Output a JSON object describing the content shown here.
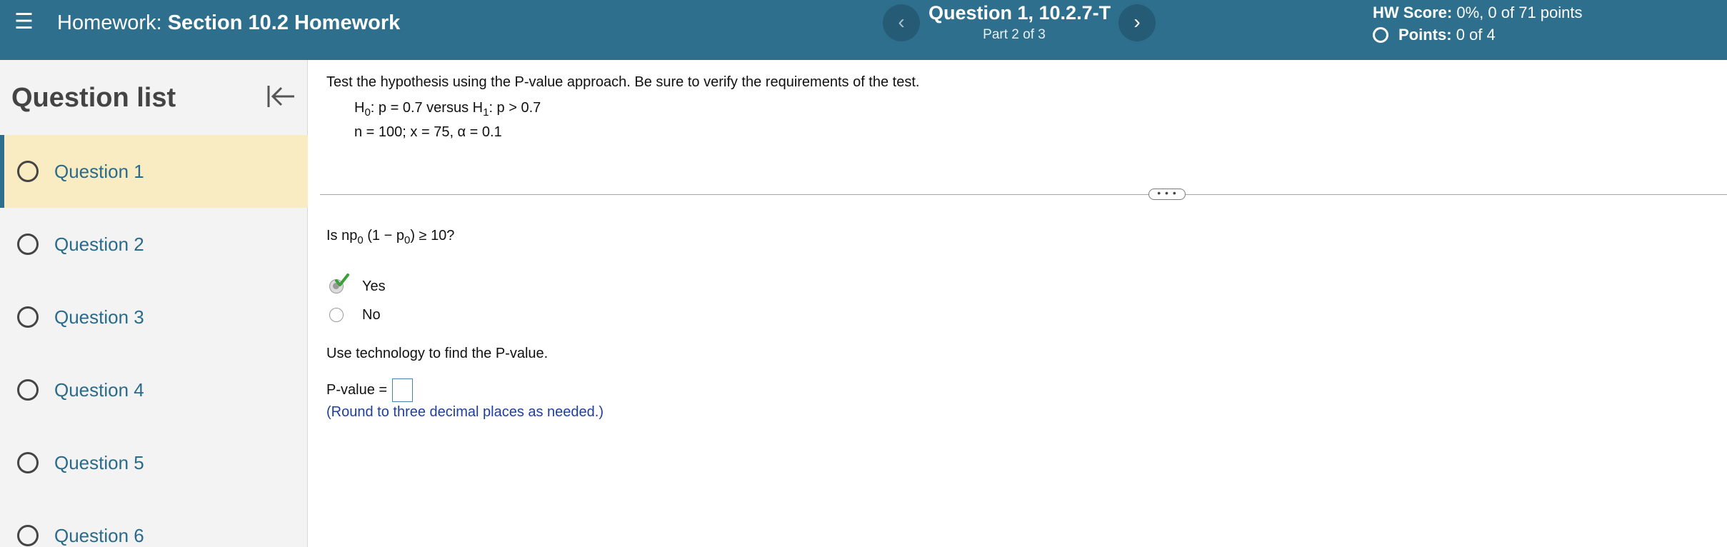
{
  "header": {
    "menu_icon": "hamburger-menu-icon",
    "title_prefix": "Homework:",
    "title_name": "Section 10.2 Homework",
    "prev_label": "‹",
    "next_label": "›",
    "question_title": "Question 1, 10.2.7-T",
    "part": "Part 2 of 3",
    "score_label": "HW Score:",
    "score_value": "0%, 0 of 71 points",
    "points_label": "Points:",
    "points_value": "0 of 4"
  },
  "sidebar": {
    "heading": "Question list",
    "collapse_icon": "collapse-left-icon",
    "items": [
      {
        "label": "Question 1",
        "active": true
      },
      {
        "label": "Question 2",
        "active": false
      },
      {
        "label": "Question 3",
        "active": false
      },
      {
        "label": "Question 4",
        "active": false
      },
      {
        "label": "Question 5",
        "active": false
      },
      {
        "label": "Question 6",
        "active": false
      }
    ]
  },
  "question": {
    "instruction": "Test the hypothesis using the P-value approach. Be sure to verify the requirements of the test.",
    "h0_h": "H",
    "h0_sub": "0",
    "h0_rest": ": p = 0.7 versus H",
    "h1_sub": "1",
    "h1_rest": ": p > 0.7",
    "params": "n = 100; x = 75, α = 0.1",
    "check_q_pre": "Is np",
    "check_q_sub1": "0",
    "check_q_mid": "(1 − p",
    "check_q_sub2": "0",
    "check_q_post": ") ≥ 10?",
    "options": [
      {
        "label": "Yes",
        "selected": true
      },
      {
        "label": "No",
        "selected": false
      }
    ],
    "tech_prompt": "Use technology to find the P-value.",
    "pvalue_label": "P-value =",
    "pvalue_input": "",
    "round_hint": "(Round to three decimal places as needed.)",
    "divider_handle": "• • •"
  },
  "colors": {
    "header_bg": "#2e6f8e",
    "active_item_bg": "#f9ecc3",
    "link_text": "#2a6a8a",
    "hint_text": "#1f3fa0",
    "check_green": "#3aa03a"
  }
}
